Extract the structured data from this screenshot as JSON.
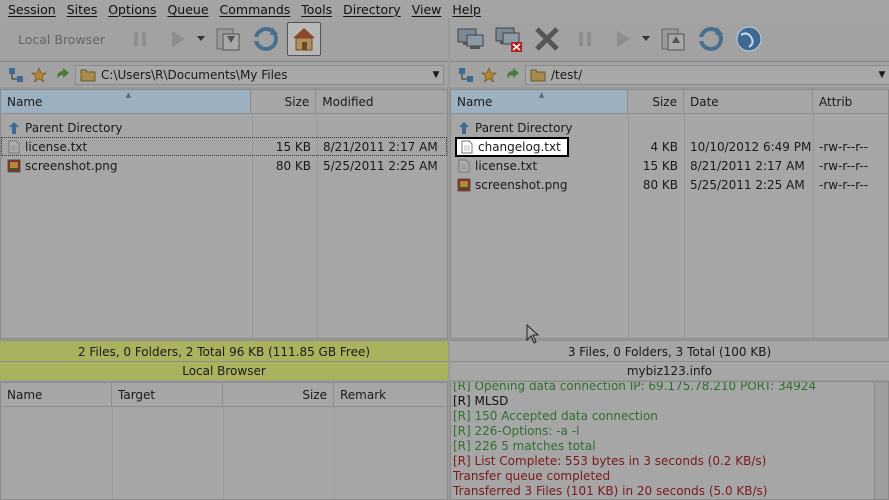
{
  "menu": [
    "Session",
    "Sites",
    "Options",
    "Queue",
    "Commands",
    "Tools",
    "Directory",
    "View",
    "Help"
  ],
  "toolbar_left": {
    "local_browser_label": "Local Browser"
  },
  "left_path": "C:\\Users\\R\\Documents\\My Files",
  "right_path": "/test/",
  "left_headers": {
    "name": "Name",
    "size": "Size",
    "modified": "Modified"
  },
  "right_headers": {
    "name": "Name",
    "size": "Size",
    "date": "Date",
    "attrib": "Attrib"
  },
  "left_files": [
    {
      "name": "Parent Directory",
      "size": "",
      "modified": "",
      "icon": "parent-dir-icon"
    },
    {
      "name": "license.txt",
      "size": "15 KB",
      "modified": "8/21/2011 2:17 AM",
      "icon": "text-file-icon"
    },
    {
      "name": "screenshot.png",
      "size": "80 KB",
      "modified": "5/25/2011 2:25 AM",
      "icon": "image-file-icon"
    }
  ],
  "right_files": [
    {
      "name": "Parent Directory",
      "size": "",
      "date": "",
      "attrib": "",
      "icon": "parent-dir-icon"
    },
    {
      "name": "changelog.txt",
      "size": "4 KB",
      "date": "10/10/2012 6:49 PM",
      "attrib": "-rw-r--r--",
      "icon": "text-file-icon"
    },
    {
      "name": "license.txt",
      "size": "15 KB",
      "date": "8/21/2011 2:17 AM",
      "attrib": "-rw-r--r--",
      "icon": "text-file-icon"
    },
    {
      "name": "screenshot.png",
      "size": "80 KB",
      "date": "5/25/2011 2:25 AM",
      "attrib": "-rw-r--r--",
      "icon": "image-file-icon"
    }
  ],
  "left_status": {
    "summary": "2 Files, 0 Folders, 2 Total 96 KB (111.85 GB Free)",
    "label": "Local Browser"
  },
  "right_status": {
    "summary": "3 Files, 0 Folders, 3 Total (100 KB)",
    "label": "mybiz123.info"
  },
  "queue_headers": {
    "name": "Name",
    "target": "Target",
    "size": "Size",
    "remark": "Remark"
  },
  "log": [
    {
      "text": "[R] Opening data connection IP: 69.175.78.210 PORT: 34924",
      "color": "#2f6f2f"
    },
    {
      "text": "[R] MLSD",
      "color": "#111111"
    },
    {
      "text": "[R] 150 Accepted data connection",
      "color": "#2f6f2f"
    },
    {
      "text": "[R] 226-Options: -a -l",
      "color": "#2f6f2f"
    },
    {
      "text": "[R] 226 5 matches total",
      "color": "#2f6f2f"
    },
    {
      "text": "[R] List Complete: 553 bytes in 3 seconds (0.2 KB/s)",
      "color": "#7a1a1a"
    },
    {
      "text": "Transfer queue completed",
      "color": "#7a1a1a"
    },
    {
      "text": "Transferred 3 Files (101 KB) in 20 seconds (5.0 KB/s)",
      "color": "#7a1a1a"
    }
  ]
}
